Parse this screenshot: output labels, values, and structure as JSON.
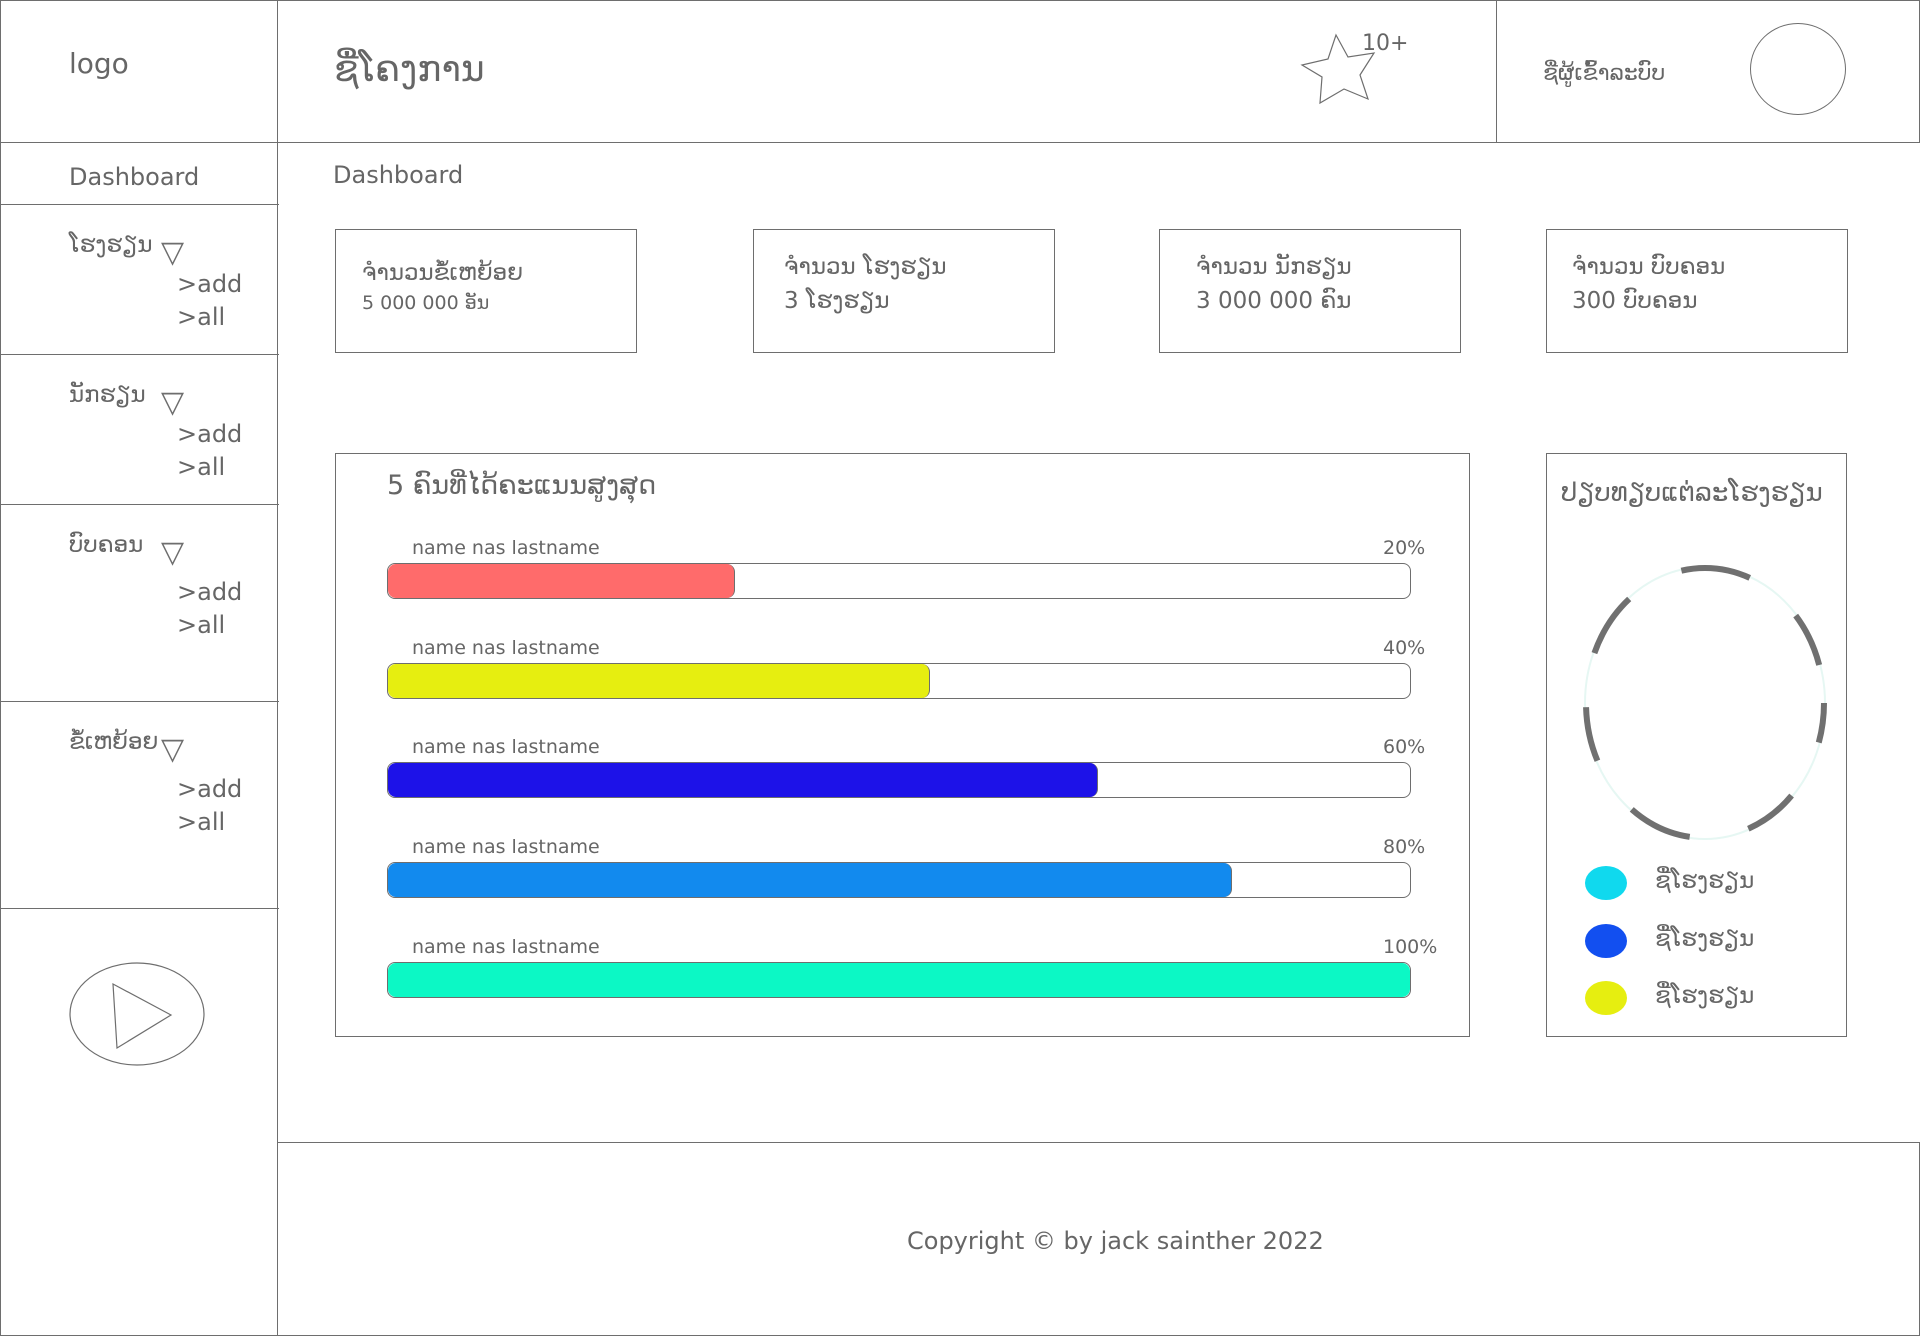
{
  "header": {
    "logo_text": "logo",
    "app_title": "ຊື່ໂຄງການ",
    "notif_icon": "star-icon",
    "notif_count": "10+",
    "user_label": "ຊື່ຜູ້ເຂົ້າລະບົບ"
  },
  "sidebar": {
    "dashboard_label": "Dashboard",
    "sections": [
      {
        "label": "ໂຮງຮຽນ",
        "add": ">add",
        "all": ">all"
      },
      {
        "label": "ນັກຮຽນ",
        "add": ">add",
        "all": ">all"
      },
      {
        "label": "ບົບຄອນ",
        "add": ">add",
        "all": ">all"
      },
      {
        "label": "ຂໍ້ເຫຍ້ອຍ",
        "add": ">add",
        "all": ">all"
      }
    ],
    "play_icon": "play-icon"
  },
  "main": {
    "breadcrumb": "Dashboard",
    "stats": [
      {
        "label": "ຈຳນວນຂໍ້ເຫຍ້ອຍ",
        "value": "5 000 000 ອັນ"
      },
      {
        "label": "ຈຳນວນ ໂຮງຮຽນ",
        "value": "3 ໂຮງຮຽນ"
      },
      {
        "label": "ຈຳນວນ ນັກຮຽນ",
        "value": "3 000 000 ຄົນ"
      },
      {
        "label": "ຈຳນວນ ບົບຄອນ",
        "value": "300 ບົບຄອນ"
      }
    ],
    "top_panel": {
      "title": "5 ຄົນທີ່ໄດ້ຄະແນນສູງສຸດ",
      "rows": [
        {
          "name": "name nas lastname",
          "pct": "20%",
          "color": "#ff6b6b",
          "fill": 0.34
        },
        {
          "name": "name nas lastname",
          "pct": "40%",
          "color": "#e6ee10",
          "fill": 0.53
        },
        {
          "name": "name nas lastname",
          "pct": "60%",
          "color": "#1d12e8",
          "fill": 0.695
        },
        {
          "name": "name nas lastname",
          "pct": "80%",
          "color": "#128aee",
          "fill": 0.826
        },
        {
          "name": "name nas lastname",
          "pct": "100%",
          "color": "#0cf8c5",
          "fill": 1.0
        }
      ]
    },
    "compare_panel": {
      "title": "ປຽບທຽບແຕ່ລະໂຮງຮຽນ",
      "legend": [
        {
          "label": "ຊື່ໂຮງຮຽນ",
          "color": "#10d9ee"
        },
        {
          "label": "ຊື່ໂຮງຮຽນ",
          "color": "#124ff0"
        },
        {
          "label": "ຊື່ໂຮງຮຽນ",
          "color": "#e6ee10"
        }
      ]
    }
  },
  "footer": {
    "copyright": "Copyright © by jack sainther 2022"
  }
}
